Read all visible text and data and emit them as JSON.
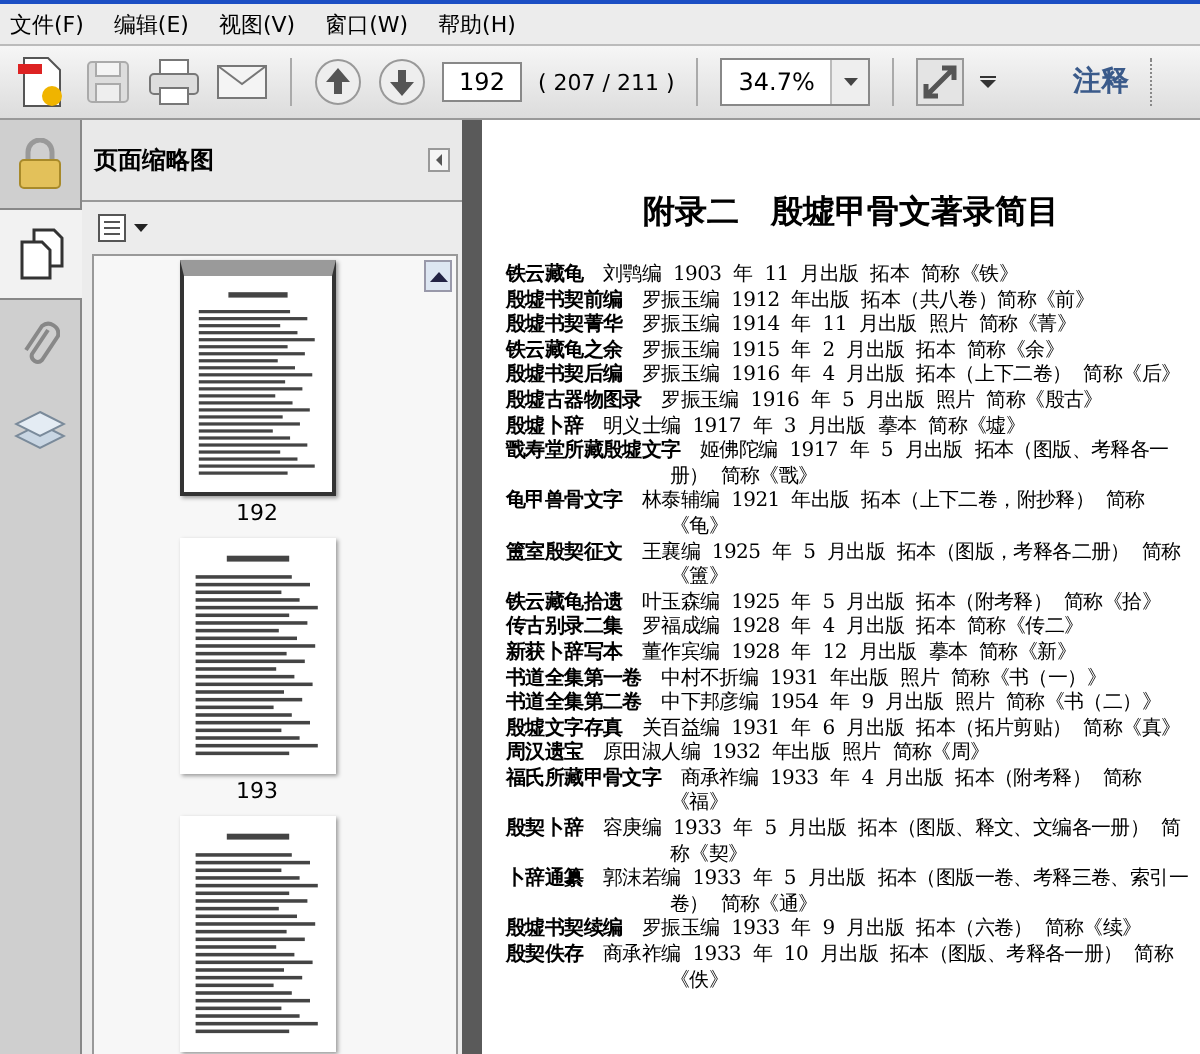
{
  "menus": [
    {
      "label": "文件(F)"
    },
    {
      "label": "编辑(E)"
    },
    {
      "label": "视图(V)"
    },
    {
      "label": "窗口(W)"
    },
    {
      "label": "帮助(H)"
    }
  ],
  "toolbar": {
    "page_value": "192",
    "page_count": "( 207 / 211 )",
    "zoom_value": "34.7%",
    "comment_label": "注释"
  },
  "rail_tabs": [
    {
      "kind": "lock",
      "selected": false
    },
    {
      "kind": "pages",
      "selected": true
    },
    {
      "kind": "clip",
      "selected": false
    },
    {
      "kind": "layers",
      "selected": false
    }
  ],
  "sidebar": {
    "title": "页面缩略图",
    "thumbnails": [
      {
        "label": "192",
        "selected": true
      },
      {
        "label": "193",
        "selected": false
      },
      {
        "selected": false
      }
    ]
  },
  "document": {
    "title": "附录二　殷墟甲骨文著录简目",
    "entries": [
      {
        "title": "铁云藏龟",
        "detail": "刘鹗编 1903 年 11 月出版 拓本 简称《铁》"
      },
      {
        "title": "殷墟书契前编",
        "detail": "罗振玉编 1912 年出版 拓本（共八卷）简称《前》"
      },
      {
        "title": "殷墟书契菁华",
        "detail": "罗振玉编 1914 年 11 月出版 照片 简称《菁》"
      },
      {
        "title": "铁云藏龟之余",
        "detail": "罗振玉编 1915 年 2 月出版 拓本 简称《余》"
      },
      {
        "title": "殷墟书契后编",
        "detail": "罗振玉编 1916 年 4 月出版 拓本（上下二卷） 简称《后》"
      },
      {
        "title": "殷墟古器物图录",
        "detail": "罗振玉编 1916 年 5 月出版 照片 简称《殷古》"
      },
      {
        "title": "殷墟卜辞",
        "detail": "明义士编 1917 年 3 月出版 摹本 简称《墟》"
      },
      {
        "title": "戬寿堂所藏殷墟文字",
        "detail": "姬佛陀编 1917 年 5 月出版 拓本（图版、考释各一册） 简称《戬》"
      },
      {
        "title": "龟甲兽骨文字",
        "detail": "林泰辅编 1921 年出版 拓本（上下二卷，附抄释） 简称《龟》"
      },
      {
        "title": "簠室殷契征文",
        "detail": "王襄编 1925 年 5 月出版 拓本（图版，考释各二册） 简称《簠》"
      },
      {
        "title": "铁云藏龟拾遗",
        "detail": "叶玉森编 1925 年 5 月出版 拓本（附考释） 简称《拾》"
      },
      {
        "title": "传古别录二集",
        "detail": "罗福成编 1928 年 4 月出版 拓本 简称《传二》"
      },
      {
        "title": "新获卜辞写本",
        "detail": "董作宾编 1928 年 12 月出版 摹本 简称《新》"
      },
      {
        "title": "书道全集第一卷",
        "detail": "中村不折编 1931 年出版 照片 简称《书（一）》"
      },
      {
        "title": "书道全集第二卷",
        "detail": "中下邦彦编 1954 年 9 月出版 照片 简称《书（二）》"
      },
      {
        "title": "殷墟文字存真",
        "detail": "关百益编 1931 年 6 月出版 拓本（拓片剪贴） 简称《真》"
      },
      {
        "title": "周汉遗宝",
        "detail": "原田淑人编 1932 年出版 照片 简称《周》"
      },
      {
        "title": "福氏所藏甲骨文字",
        "detail": "商承祚编 1933 年 4 月出版 拓本（附考释） 简称《福》"
      },
      {
        "title": "殷契卜辞",
        "detail": "容庚编 1933 年 5 月出版 拓本（图版、释文、文编各一册） 简称《契》"
      },
      {
        "title": "卜辞通纂",
        "detail": "郭沫若编 1933 年 5 月出版 拓本（图版一卷、考释三卷、索引一卷） 简称《通》"
      },
      {
        "title": "殷墟书契续编",
        "detail": "罗振玉编 1933 年 9 月出版 拓本（六卷） 简称《续》"
      },
      {
        "title": "殷契佚存",
        "detail": "商承祚编 1933 年 10 月出版 拓本（图版、考释各一册） 简称《佚》"
      }
    ]
  }
}
